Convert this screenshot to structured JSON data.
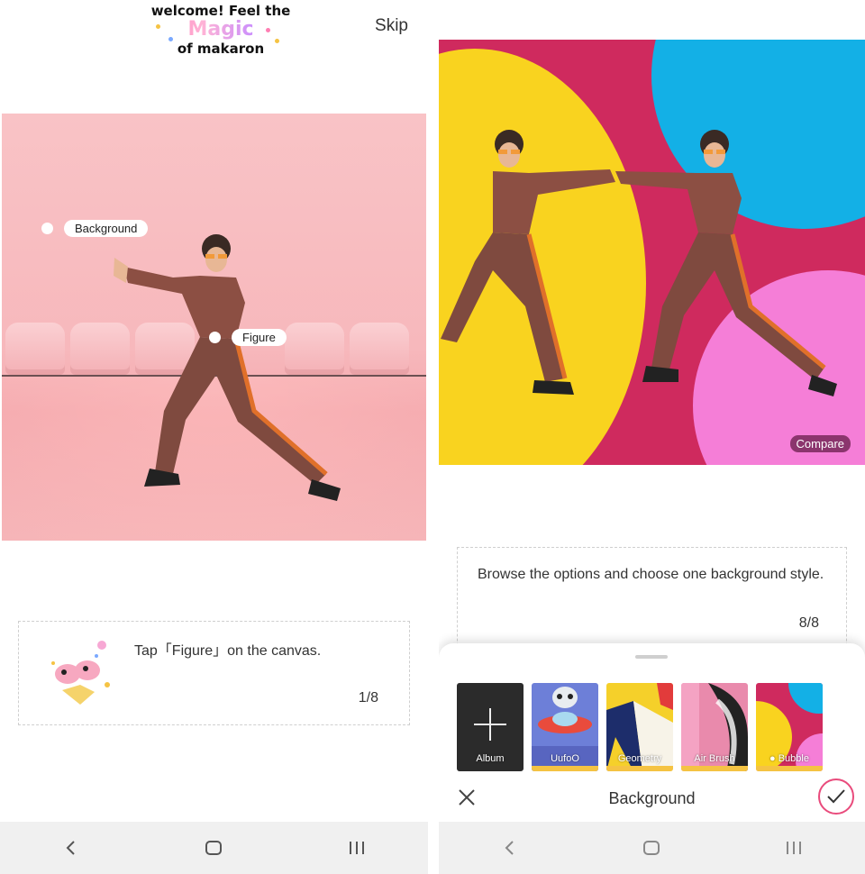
{
  "left": {
    "welcome": {
      "line1": "welcome! Feel the",
      "line2": "Magic",
      "line3": "of makaron"
    },
    "skip_label": "Skip",
    "tags": {
      "background": "Background",
      "figure": "Figure"
    },
    "hint": {
      "text": "Tap「Figure」on the canvas.",
      "page": "1/8"
    }
  },
  "right": {
    "compare_label": "Compare",
    "hint": {
      "text": "Browse the options and choose one background style.",
      "page": "8/8"
    },
    "sheet": {
      "title": "Background",
      "thumbs": [
        {
          "label": "Album",
          "icon": "plus-icon"
        },
        {
          "label": "UufoO"
        },
        {
          "label": "Geometry"
        },
        {
          "label": "Air Brush"
        },
        {
          "label": "Bubble",
          "selected": true
        }
      ]
    }
  },
  "colors": {
    "accent_pink": "#e94b7c",
    "bubble_red": "#cf2a5e",
    "bubble_yellow": "#f9d31f",
    "bubble_blue": "#13b0e6",
    "bubble_pink": "#f57ed7",
    "thumb_bar": "#f5c343"
  },
  "icons": {
    "nav": [
      "back-icon",
      "home-icon",
      "recents-icon"
    ]
  }
}
